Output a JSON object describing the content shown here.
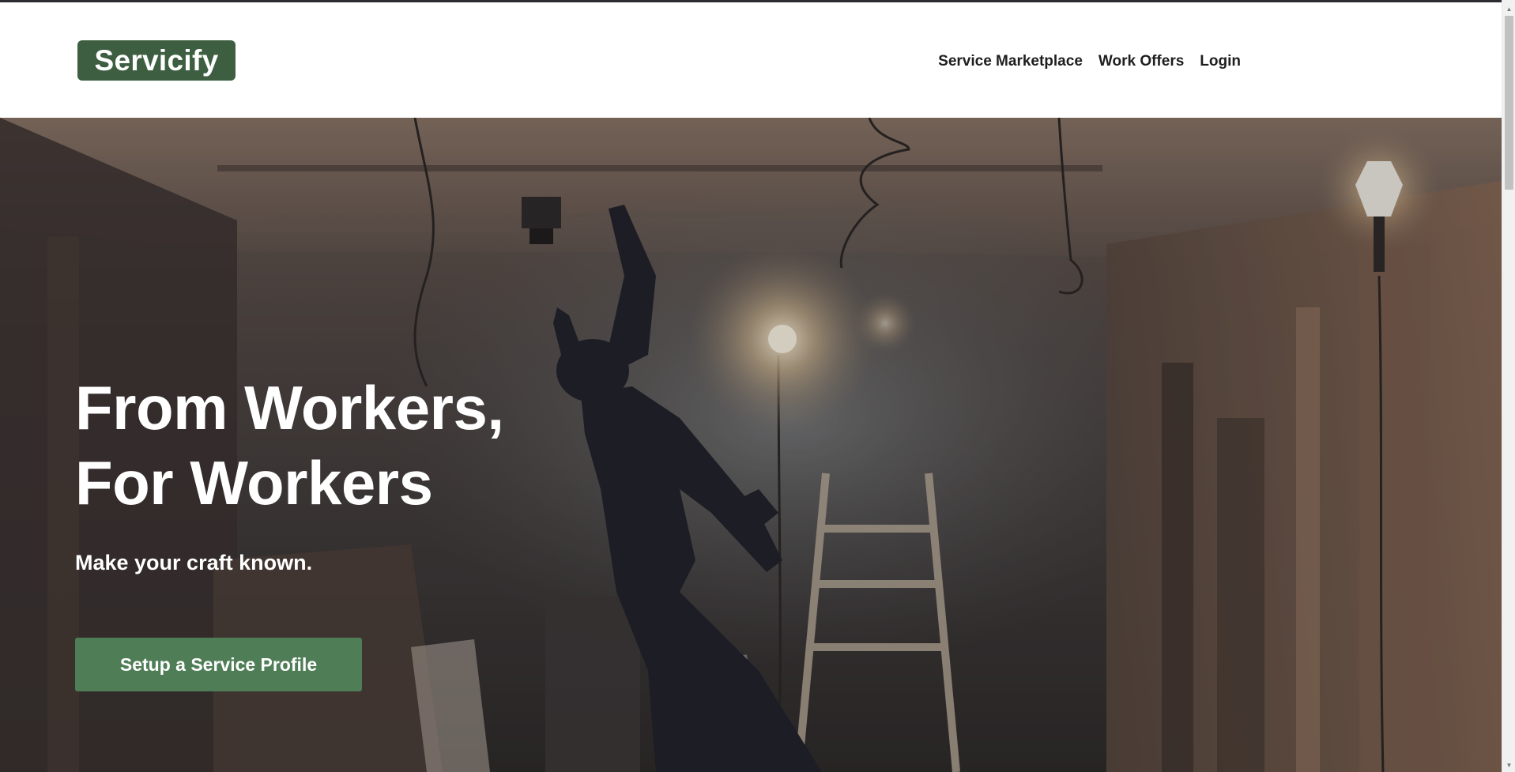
{
  "header": {
    "logo_text": "Servicify",
    "nav": [
      {
        "label": "Service Marketplace"
      },
      {
        "label": "Work Offers"
      },
      {
        "label": "Login"
      }
    ]
  },
  "hero": {
    "title_line1": "From Workers,",
    "title_line2": "For Workers",
    "subtitle": "Make your craft known.",
    "cta_label": "Setup a Service Profile",
    "background_image": "construction-worker-photo"
  },
  "colors": {
    "brand": "#3d5e41",
    "cta": "#4f7d56",
    "nav_text": "#1e1e1e"
  }
}
